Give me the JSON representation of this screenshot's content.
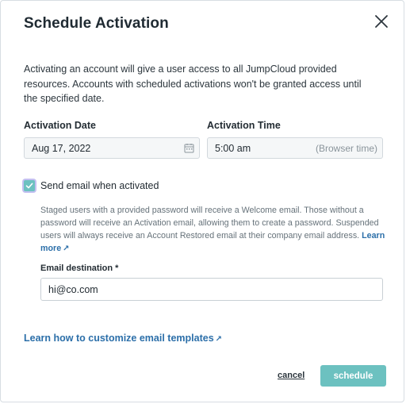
{
  "dialog": {
    "title": "Schedule Activation",
    "intro": "Activating an account will give a user access to all JumpCloud provided resources. Accounts with scheduled activations won't be granted access until the specified date."
  },
  "activation_date": {
    "label": "Activation Date",
    "value": "Aug 17, 2022",
    "icon": "calendar-icon"
  },
  "activation_time": {
    "label": "Activation Time",
    "value": "5:00 am",
    "suffix": "(Browser time)"
  },
  "send_email": {
    "checked": true,
    "label": "Send email when activated",
    "note": "Staged users with a provided password will receive a Welcome email. Those without a password will receive an Activation email, allowing them to create a password. Suspended users will always receive an Account Restored email at their company email address.",
    "learn_more": "Learn more"
  },
  "email_destination": {
    "label": "Email destination *",
    "value": "hi@co.com"
  },
  "customize_link": "Learn how to customize email templates",
  "footer": {
    "cancel_label": "cancel",
    "schedule_label": "schedule"
  },
  "colors": {
    "accent": "#6cc1c0",
    "link": "#2c6fa9",
    "checkbox_focus": "#c4c0f1"
  }
}
